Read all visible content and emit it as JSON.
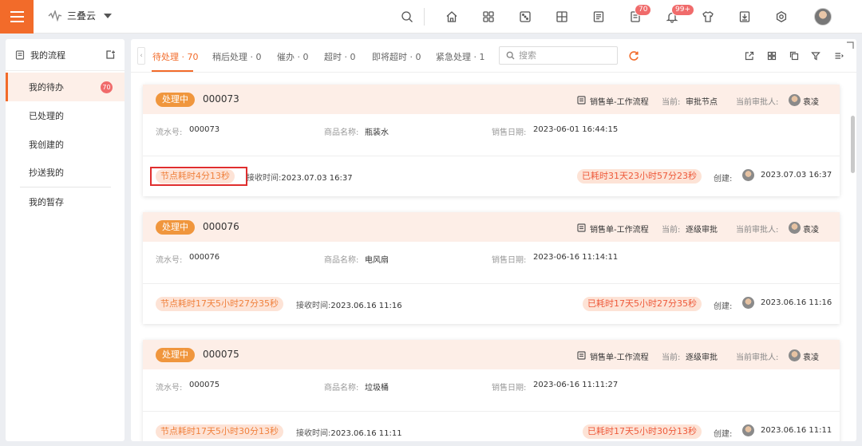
{
  "app": {
    "brand": "三叠云",
    "message_badge": "70",
    "bell_badge": "99+"
  },
  "sidebar": {
    "title": "我的流程",
    "items": [
      {
        "label": "我的待办",
        "badge": "70"
      },
      {
        "label": "已处理的"
      },
      {
        "label": "我创建的"
      },
      {
        "label": "抄送我的"
      },
      {
        "label": "我的暂存"
      }
    ]
  },
  "tabs": [
    {
      "label": "待处理 · 70"
    },
    {
      "label": "稍后处理 · 0"
    },
    {
      "label": "催办 · 0"
    },
    {
      "label": "超时 · 0"
    },
    {
      "label": "即将超时 · 0"
    },
    {
      "label": "紧急处理 · 1"
    }
  ],
  "search": {
    "placeholder": "搜索"
  },
  "labels": {
    "current": "当前:",
    "approver": "当前审批人:",
    "serial": "流水号:",
    "product": "商品名称:",
    "sale_date": "销售日期:",
    "receive": "接收时间:",
    "creator": "创建:"
  },
  "colors": {
    "accent": "#f26b2a",
    "status": "#f0963d",
    "highlight_border": "#e02e2e"
  },
  "cards": [
    {
      "status": "处理中",
      "number": "000073",
      "flow": "销售单-工作流程",
      "current_node": "审批节点",
      "approver": "袁凌",
      "serial": "000073",
      "product": "瓶装水",
      "sale_date": "2023-06-01 16:44:15",
      "node_elapsed": "节点耗时4分13秒",
      "receive_time": "2023.07.03 16:37",
      "total_elapsed": "已耗时31天23小时57分23秒",
      "created": "2023.07.03 16:37"
    },
    {
      "status": "处理中",
      "number": "000076",
      "flow": "销售单-工作流程",
      "current_node": "逐级审批",
      "approver": "袁凌",
      "serial": "000076",
      "product": "电风扇",
      "sale_date": "2023-06-16 11:14:11",
      "node_elapsed": "节点耗时17天5小时27分35秒",
      "receive_time": "2023.06.16 11:16",
      "total_elapsed": "已耗时17天5小时27分35秒",
      "created": "2023.06.16 11:16"
    },
    {
      "status": "处理中",
      "number": "000075",
      "flow": "销售单-工作流程",
      "current_node": "逐级审批",
      "approver": "袁凌",
      "serial": "000075",
      "product": "垃圾桶",
      "sale_date": "2023-06-16 11:11:27",
      "node_elapsed": "节点耗时17天5小时30分13秒",
      "receive_time": "2023.06.16 11:11",
      "total_elapsed": "已耗时17天5小时30分13秒",
      "created": "2023.06.16 11:11"
    }
  ]
}
